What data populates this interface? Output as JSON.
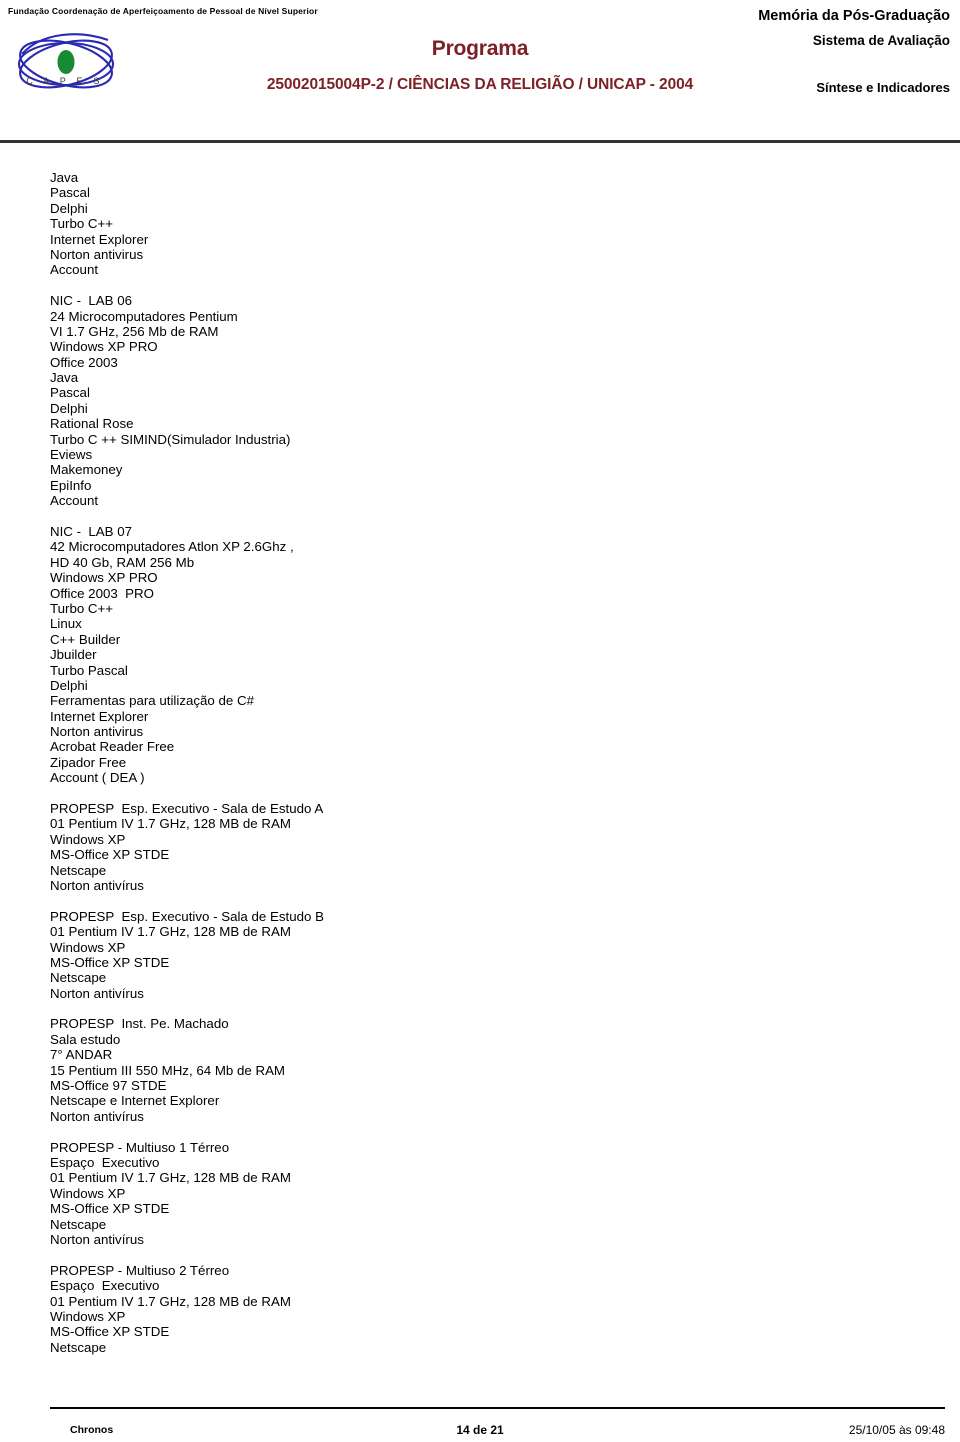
{
  "header": {
    "tagline": "Fundação Coordenação de Aperfeiçoamento de Pessoal de Nível Superior",
    "logo_wordmark": "C A P E S",
    "title": "Programa",
    "subtitle": "25002015004P-2 /  CIÊNCIAS DA RELIGIÃO / UNICAP - 2004",
    "right_line1": "Memória da Pós-Graduação",
    "right_line2": "Sistema de Avaliação",
    "right_line3": "Síntese e Indicadores",
    "accent_color": "#7c2226",
    "rule_color": "#333333"
  },
  "body": {
    "lines": [
      "Java",
      "Pascal",
      "Delphi",
      "Turbo C++",
      "Internet Explorer",
      "Norton antivirus",
      "Account",
      "",
      "NIC -  LAB 06",
      "24 Microcomputadores Pentium",
      "VI 1.7 GHz, 256 Mb de RAM",
      "Windows XP PRO",
      "Office 2003",
      "Java",
      "Pascal",
      "Delphi",
      "Rational Rose",
      "Turbo C ++ SIMIND(Simulador Industria)",
      "Eviews",
      "Makemoney",
      "EpiInfo",
      "Account",
      "",
      "NIC -  LAB 07",
      "42 Microcomputadores Atlon XP 2.6Ghz ,",
      "HD 40 Gb, RAM 256 Mb",
      "Windows XP PRO",
      "Office 2003  PRO",
      "Turbo C++",
      "Linux",
      "C++ Builder",
      "Jbuilder",
      "Turbo Pascal",
      "Delphi",
      "Ferramentas para utilização de C#",
      "Internet Explorer",
      "Norton antivirus",
      "Acrobat Reader Free",
      "Zipador Free",
      "Account ( DEA )",
      "",
      "PROPESP  Esp. Executivo - Sala de Estudo A",
      "01 Pentium IV 1.7 GHz, 128 MB de RAM",
      "Windows XP",
      "MS-Office XP STDE",
      "Netscape",
      "Norton antivírus",
      "",
      "PROPESP  Esp. Executivo - Sala de Estudo B",
      "01 Pentium IV 1.7 GHz, 128 MB de RAM",
      "Windows XP",
      "MS-Office XP STDE",
      "Netscape",
      "Norton antivírus",
      "",
      "PROPESP  Inst. Pe. Machado",
      "Sala estudo",
      "7° ANDAR",
      "15 Pentium III 550 MHz, 64 Mb de RAM",
      "MS-Office 97 STDE",
      "Netscape e Internet Explorer",
      "Norton antivírus",
      "",
      "PROPESP - Multiuso 1 Térreo",
      "Espaço  Executivo",
      "01 Pentium IV 1.7 GHz, 128 MB de RAM",
      "Windows XP",
      "MS-Office XP STDE",
      "Netscape",
      "Norton antivírus",
      "",
      "PROPESP - Multiuso 2 Térreo",
      "Espaço  Executivo",
      "01 Pentium IV 1.7 GHz, 128 MB de RAM",
      "Windows XP",
      "MS-Office XP STDE",
      "Netscape"
    ]
  },
  "footer": {
    "system_name": "Chronos",
    "page_indicator": "14 de 21",
    "timestamp": "25/10/05 às 09:48"
  }
}
